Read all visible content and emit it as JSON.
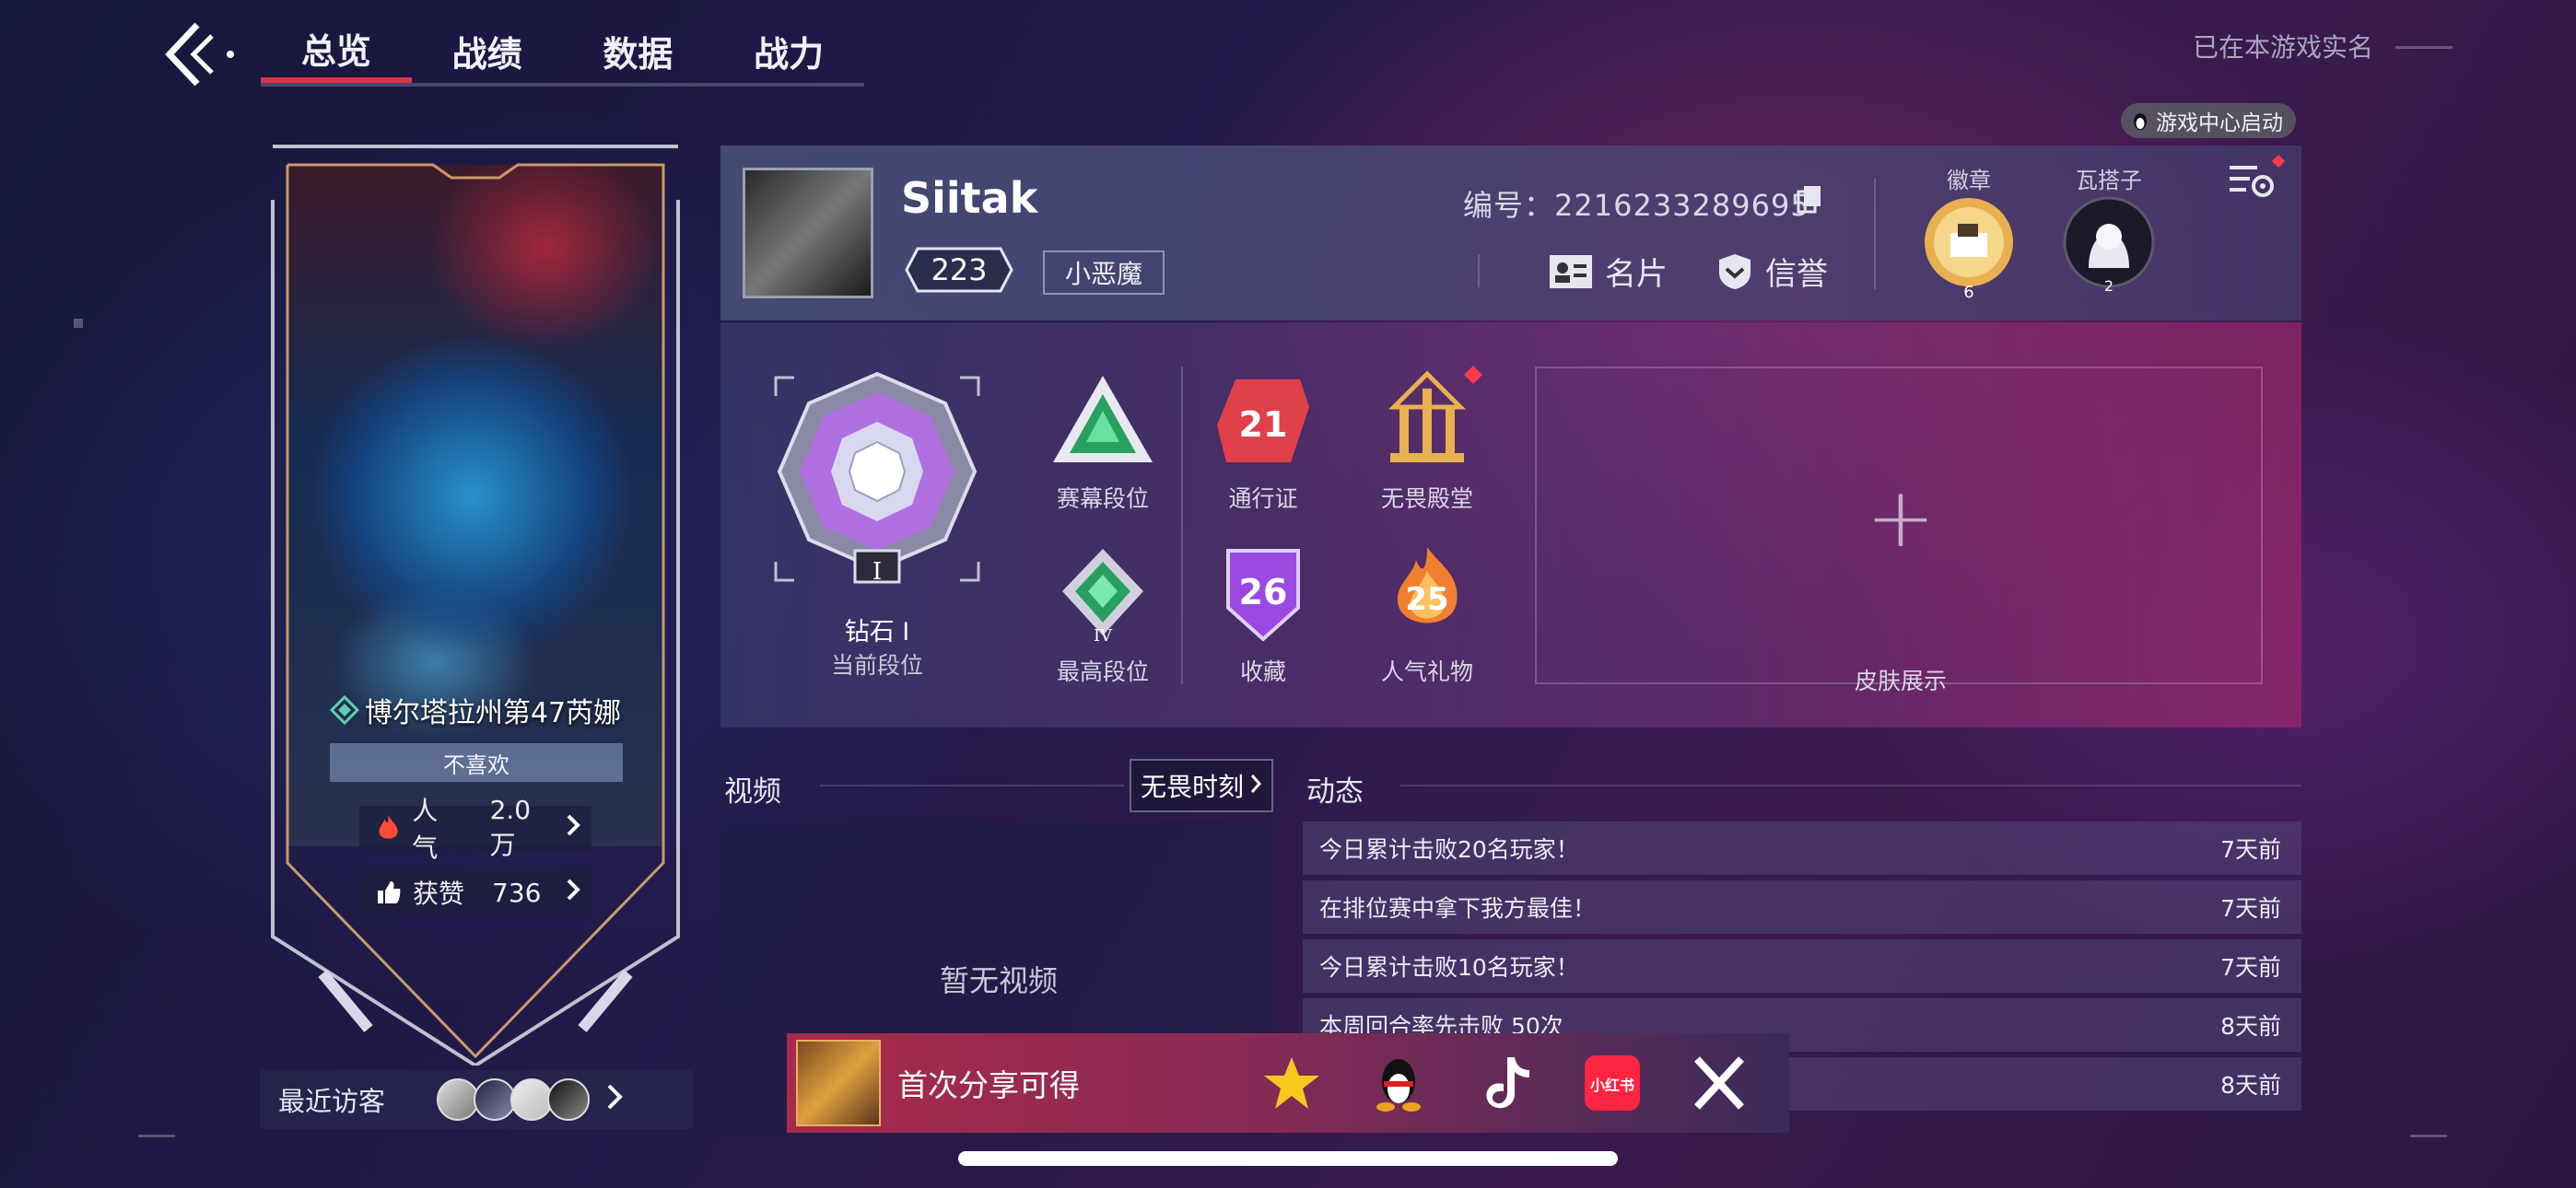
{
  "nav": {
    "tabs": [
      {
        "label": "总览",
        "active": true
      },
      {
        "label": "战绩",
        "active": false
      },
      {
        "label": "数据",
        "active": false
      },
      {
        "label": "战力",
        "active": false
      }
    ],
    "realname": "已在本游戏实名",
    "game_center_badge": "游戏中心启动"
  },
  "hero": {
    "name": "博尔塔拉州第47芮娜",
    "dislike_label": "不喜欢",
    "popularity_label": "人气",
    "popularity_value": "2.0万",
    "likes_label": "获赞",
    "likes_value": "736"
  },
  "visitors": {
    "label": "最近访客"
  },
  "profile": {
    "name": "Siitak",
    "level": "223",
    "title": "小恶魔",
    "id_label": "编号：",
    "id_value": "2216233289695",
    "card_label": "名片",
    "credit_label": "信誉",
    "badge_label": "徽章",
    "badge_count": "6",
    "ward_label": "瓦搭子",
    "ward_count": "2"
  },
  "rank": {
    "current_name": "钻石 I",
    "current_caption": "当前段位",
    "current_tier_numeral": "I",
    "items": [
      {
        "caption": "赛幕段位"
      },
      {
        "caption": "通行证",
        "value": "21"
      },
      {
        "caption": "无畏殿堂"
      },
      {
        "caption": "最高段位",
        "numeral": "IV"
      },
      {
        "caption": "收藏",
        "value": "26"
      },
      {
        "caption": "人气礼物",
        "value": "25"
      }
    ],
    "skin_caption": "皮肤展示"
  },
  "video": {
    "title": "视频",
    "button": "无畏时刻",
    "empty": "暂无视频"
  },
  "feed": {
    "title": "动态",
    "rows": [
      {
        "text": "今日累计击败20名玩家！",
        "time": "7天前"
      },
      {
        "text": "在排位赛中拿下我方最佳！",
        "time": "7天前"
      },
      {
        "text": "今日累计击败10名玩家！",
        "time": "7天前"
      },
      {
        "text": "本周回合率先击败 50次",
        "time": "8天前"
      },
      {
        "text": "",
        "time": "8天前"
      }
    ]
  },
  "share": {
    "text": "首次分享可得",
    "icons": [
      "qzone-icon",
      "qq-icon",
      "douyin-icon",
      "xiaohongshu-icon",
      "x-icon"
    ],
    "xiaohongshu_label": "小红书"
  },
  "colors": {
    "accent_red": "#e0324a",
    "gold": "#e8b050"
  }
}
